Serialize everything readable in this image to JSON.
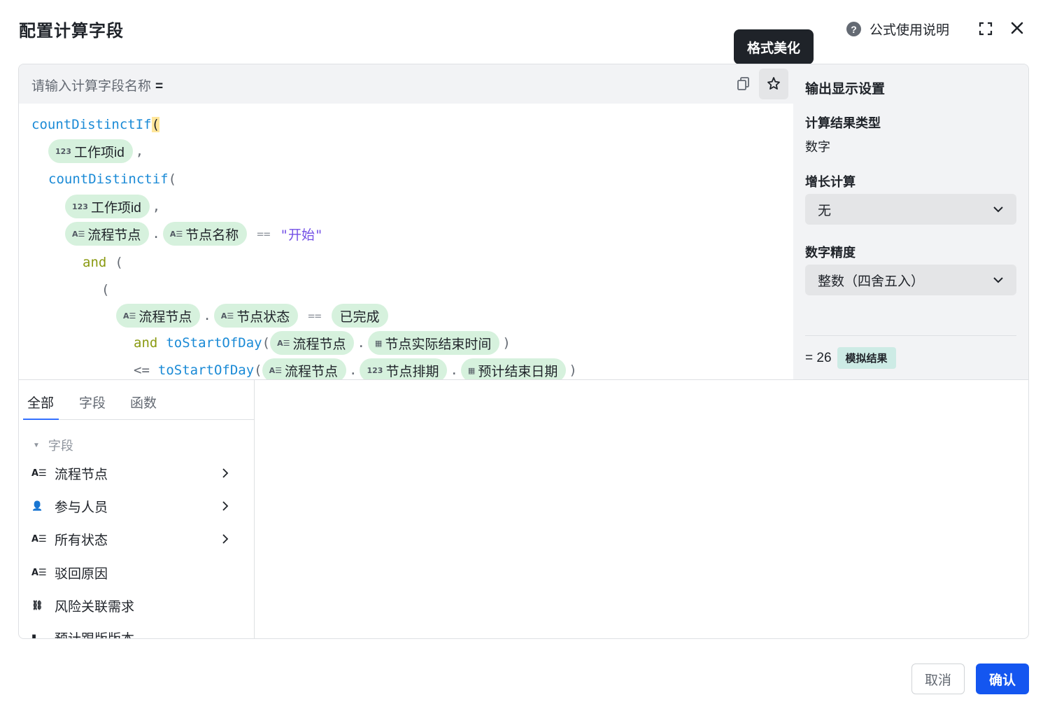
{
  "dialog": {
    "title": "配置计算字段",
    "help_label": "公式使用说明",
    "tooltip": "格式美化"
  },
  "editor": {
    "name_placeholder": "请输入计算字段名称",
    "equals": "=",
    "tokens": {
      "countDistinctIf": "countDistinctIf",
      "countDistinctif": "countDistinctif",
      "toStartOfDay": "toStartOfDay",
      "and": "and",
      "open_paren": "(",
      "close_paren": ")",
      "comma": ",",
      "dot": ".",
      "eq_op": "==",
      "le_op": "<=",
      "str_start": "\"开始\"",
      "num_icon": "123",
      "text_icon": "A☰",
      "date_icon": "▦"
    },
    "chips": {
      "work_item_id": "工作项id",
      "flow_node": "流程节点",
      "node_name": "节点名称",
      "node_status": "节点状态",
      "done": "已完成",
      "actual_end": "节点实际结束时间",
      "node_schedule": "节点排期",
      "est_end": "预计结束日期"
    }
  },
  "output": {
    "title": "输出显示设置",
    "result_type_label": "计算结果类型",
    "result_type_value": "数字",
    "growth_label": "增长计算",
    "growth_value": "无",
    "precision_label": "数字精度",
    "precision_value": "整数（四舍五入）",
    "result_prefix": "= 26",
    "result_badge": "模拟结果"
  },
  "tabs": [
    "全部",
    "字段",
    "函数"
  ],
  "field_group": "字段",
  "fields": [
    {
      "label": "流程节点",
      "icon": "A☰",
      "icon_name": "text-field-icon"
    },
    {
      "label": "参与人员",
      "icon": "👤",
      "icon_name": "person-field-icon"
    },
    {
      "label": "所有状态",
      "icon": "A☰",
      "icon_name": "text-field-icon"
    },
    {
      "label": "驳回原因",
      "icon": "A☰",
      "icon_name": "text-field-icon"
    },
    {
      "label": "风险关联需求",
      "icon": "⛓",
      "icon_name": "relation-field-icon"
    },
    {
      "label": "预计跟版版本",
      "icon": "▮",
      "icon_name": "version-field-icon"
    }
  ],
  "footer": {
    "cancel": "取消",
    "confirm": "确认"
  }
}
